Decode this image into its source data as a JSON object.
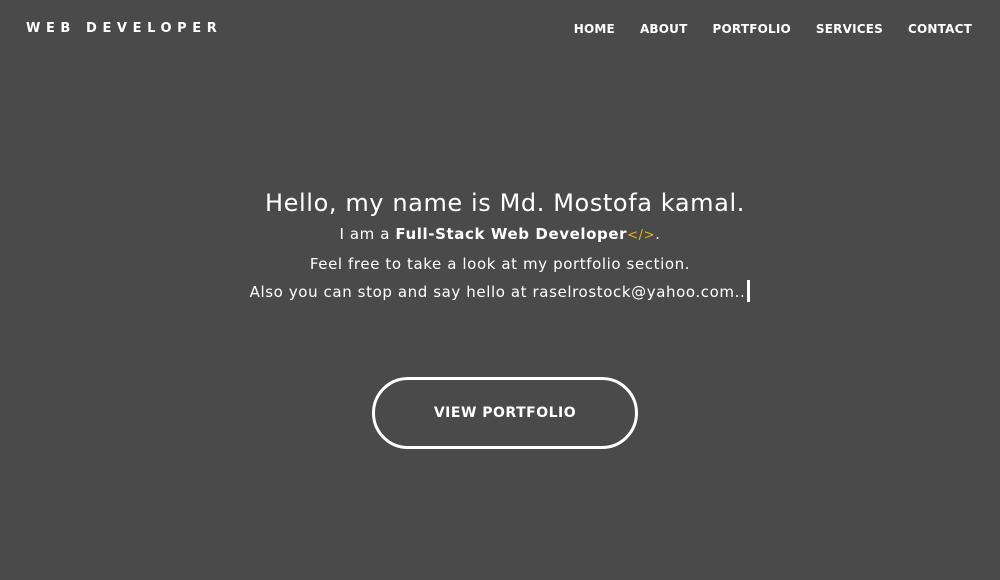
{
  "navbar": {
    "brand": "WEB DEVELOPER",
    "links": [
      "HOME",
      "ABOUT",
      "PORTFOLIO",
      "SERVICES",
      "CONTACT"
    ]
  },
  "hero": {
    "heading": "Hello, my name is Md. Mostofa kamal.",
    "line1_prefix": "I am a ",
    "line1_role": "Full-Stack Web Developer",
    "line1_icon": "</>",
    "line1_suffix": ".",
    "line2": "Feel free to take a look at my portfolio section.",
    "line3": "Also you can stop and say hello at raselrostock@yahoo.com.."
  },
  "cta": {
    "label": "VIEW PORTFOLIO"
  },
  "colors": {
    "background": "#4a4a4a",
    "text": "#ffffff",
    "code_icon": "#e2b514"
  },
  "icons": {
    "code": "code-icon",
    "cursor": "typing-cursor"
  }
}
